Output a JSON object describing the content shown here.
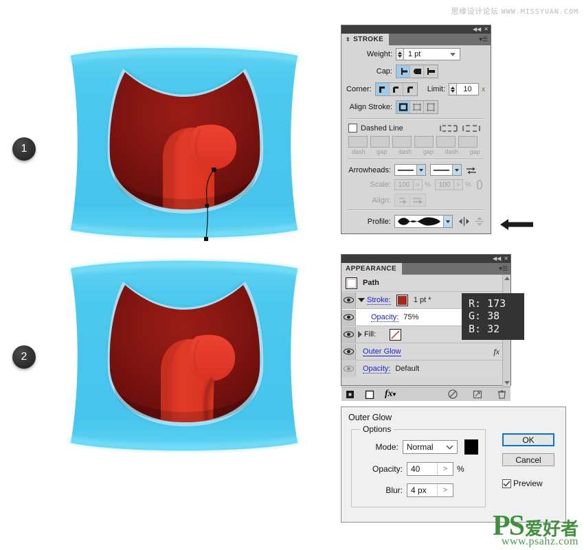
{
  "watermarks": {
    "top_cn": "思缘设计论坛",
    "top_url": "WWW.MISSYUAN.COM",
    "bottom_ps": "PS",
    "bottom_cn": "爱好者",
    "bottom_url": "www.psahz.com"
  },
  "steps": [
    {
      "number": "1",
      "name": "step-1"
    },
    {
      "number": "2",
      "name": "step-2"
    }
  ],
  "illustration": {
    "background_blue": "#4cc8ef",
    "mouth_dark_red": "#8c1a15",
    "tongue_red": "#e8392a",
    "tongue_shadow": "#cf3222",
    "lip_highlight": "#aadced",
    "path_stroke": "#000000"
  },
  "stroke_panel": {
    "tab_label": "STROKE",
    "weight": {
      "label": "Weight:",
      "value": "1 pt"
    },
    "cap": {
      "label": "Cap:",
      "options": [
        "butt-cap",
        "round-cap",
        "projecting-cap"
      ],
      "selected": 0
    },
    "corner": {
      "label": "Corner:",
      "options": [
        "miter-join",
        "round-join",
        "bevel-join"
      ],
      "selected": 0
    },
    "limit": {
      "label": "Limit:",
      "value": "10",
      "unit": "x"
    },
    "align_stroke": {
      "label": "Align Stroke:",
      "options": [
        "align-center",
        "align-inside",
        "align-outside"
      ],
      "selected": 0
    },
    "dashed_line": {
      "label": "Dashed Line",
      "checked": false
    },
    "dash_fields": [
      {
        "value": "",
        "label": "dash"
      },
      {
        "value": "",
        "label": "gap"
      },
      {
        "value": "",
        "label": "dash"
      },
      {
        "value": "",
        "label": "gap"
      },
      {
        "value": "",
        "label": "dash"
      },
      {
        "value": "",
        "label": "gap"
      }
    ],
    "arrowheads": {
      "label": "Arrowheads:",
      "start": "none",
      "end": "none"
    },
    "scale": {
      "label": "Scale:",
      "start": "100",
      "end": "100",
      "unit": "%"
    },
    "align_arrow": {
      "label": "Align:"
    },
    "profile": {
      "label": "Profile:",
      "value": "Width Profile 4"
    }
  },
  "appearance_panel": {
    "tab_label": "APPEARANCE",
    "object_type": "Path",
    "rows": [
      {
        "name": "stroke",
        "label": "Stroke:",
        "value": "1 pt *",
        "swatch": "#a92620",
        "has_triangle": "open",
        "indent": 0
      },
      {
        "name": "stroke-opacity",
        "label": "Opacity:",
        "value": "75%",
        "indent": 1
      },
      {
        "name": "fill",
        "label": "Fill:",
        "value": "",
        "swatch": "none",
        "has_triangle": "closed",
        "indent": 0
      },
      {
        "name": "outer-glow",
        "label": "Outer Glow",
        "value": "",
        "indent": 1,
        "fx": true
      },
      {
        "name": "object-opacity",
        "label": "Opacity:",
        "value": "Default",
        "indent": 1
      }
    ],
    "footer_icons": [
      "add-new-stroke",
      "add-new-fill",
      "add-new-effect",
      "clear-appearance",
      "duplicate-item",
      "delete-item"
    ]
  },
  "rgb_tooltip": {
    "r": "R: 173",
    "g": "G: 38",
    "b": "B: 32"
  },
  "outer_glow_dialog": {
    "title": "Outer Glow",
    "group_legend": "Options",
    "mode": {
      "label": "Mode:",
      "value": "Normal"
    },
    "color": "#000000",
    "opacity": {
      "label": "Opacity:",
      "value": "40",
      "unit": "%"
    },
    "blur": {
      "label": "Blur:",
      "value": "4 px"
    },
    "ok_label": "OK",
    "cancel_label": "Cancel",
    "preview": {
      "label": "Preview",
      "checked": true
    }
  }
}
